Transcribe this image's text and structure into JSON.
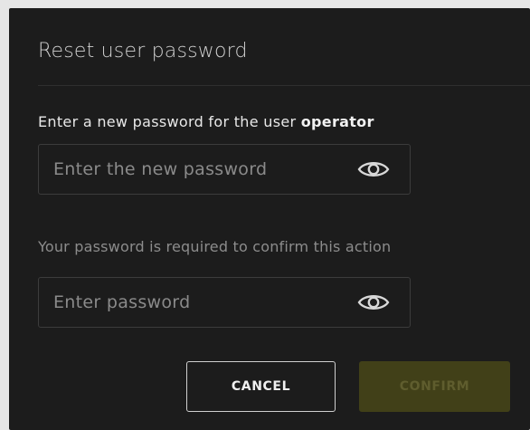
{
  "dialog": {
    "title": "Reset user password",
    "prompt_prefix": "Enter a new password for the user ",
    "username": "operator",
    "new_password_field": {
      "placeholder": "Enter the new password",
      "toggle_icon": "eye-icon"
    },
    "confirm_prompt": "Your password is required to confirm this action",
    "current_password_field": {
      "placeholder": "Enter password",
      "toggle_icon": "eye-icon"
    },
    "cancel_label": "CANCEL",
    "confirm_label": "CONFIRM",
    "colors": {
      "background": "#1c1c1c",
      "confirm_disabled_bg": "#414018",
      "confirm_disabled_text": "#5f5d2e"
    }
  }
}
